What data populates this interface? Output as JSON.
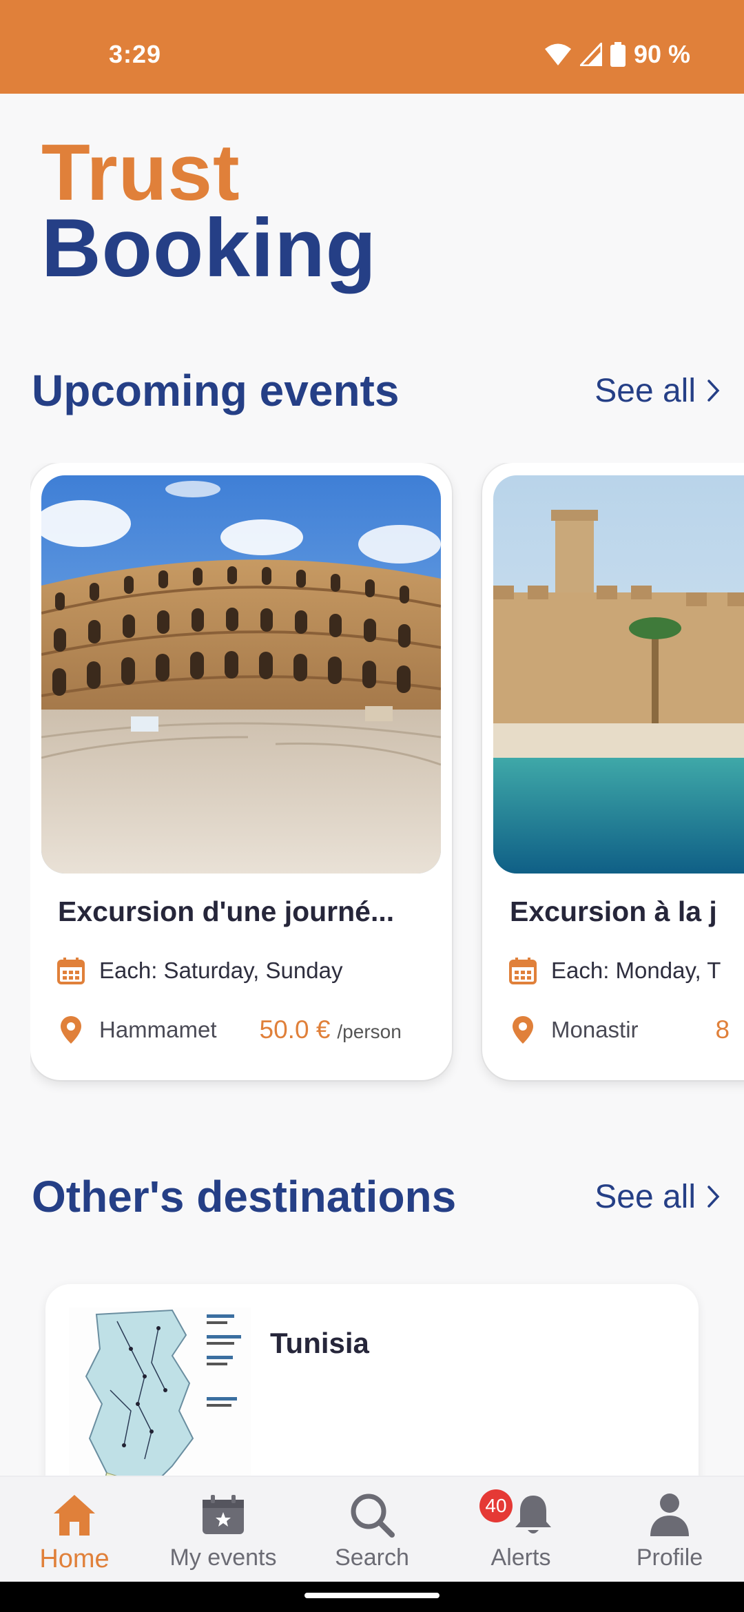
{
  "status_bar": {
    "time": "3:29",
    "battery": "90 %"
  },
  "brand": {
    "line1": "Trust",
    "line2": "Booking"
  },
  "upcoming": {
    "title": "Upcoming events",
    "see_all": "See all",
    "events": [
      {
        "title": "Excursion d'une journé...",
        "schedule": "Each: Saturday, Sunday",
        "location": "Hammamet",
        "price": "50.0 €",
        "price_unit": "/person"
      },
      {
        "title": "Excursion à la j",
        "schedule": "Each: Monday, T",
        "location": "Monastir",
        "price": "8"
      }
    ]
  },
  "destinations": {
    "title": "Other's destinations",
    "see_all": "See all",
    "items": [
      {
        "name": "Tunisia"
      }
    ]
  },
  "bottom_nav": {
    "items": [
      {
        "label": "Home",
        "active": true
      },
      {
        "label": "My events"
      },
      {
        "label": "Search"
      },
      {
        "label": "Alerts",
        "badge": "40"
      },
      {
        "label": "Profile"
      }
    ]
  },
  "colors": {
    "brand_orange": "#e0803a",
    "brand_blue": "#253f86",
    "badge_red": "#e53935"
  },
  "icons": [
    "wifi-icon",
    "signal-icon",
    "battery-icon",
    "chevron-right-icon",
    "calendar-icon",
    "location-pin-icon",
    "home-icon",
    "calendar-star-icon",
    "search-icon",
    "bell-icon",
    "person-icon"
  ]
}
